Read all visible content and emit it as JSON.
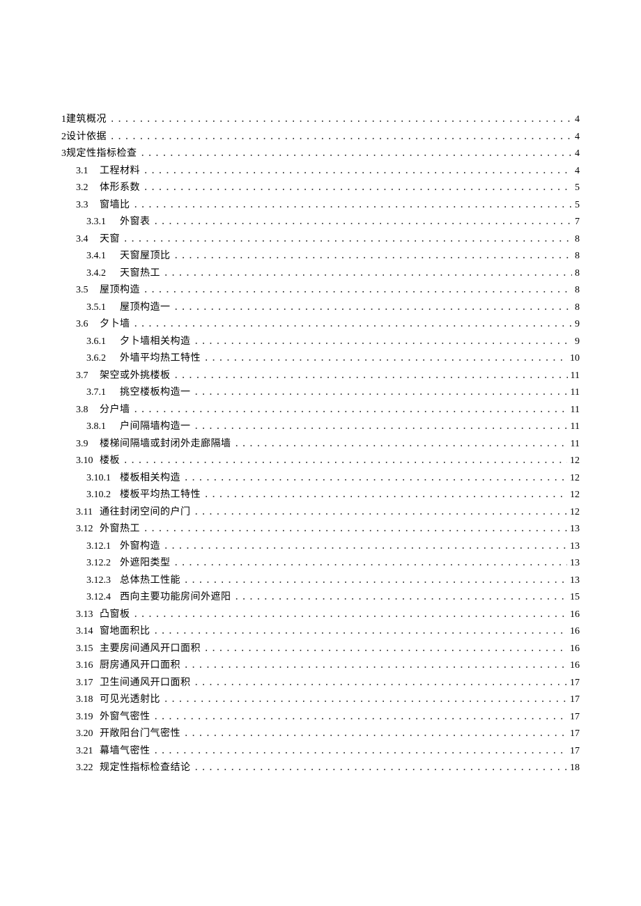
{
  "toc": [
    {
      "num": "1",
      "title": "建筑概况",
      "page": "4",
      "lvl": 1,
      "bold": false,
      "space": ""
    },
    {
      "num": "2",
      "title": "设计依据",
      "page": "4",
      "lvl": 1,
      "bold": false,
      "space": ""
    },
    {
      "num": "3",
      "title": "规定性指标检查",
      "page": "4",
      "lvl": 1,
      "bold": false,
      "space": ""
    },
    {
      "num": "3.1",
      "title": "工程材料",
      "page": "4",
      "lvl": 2,
      "bold": false,
      "space": ""
    },
    {
      "num": "3.2",
      "title": "体形系数",
      "page": "5",
      "lvl": 2,
      "bold": false,
      "space": ""
    },
    {
      "num": "3.3",
      "title": "窗墙比",
      "page": "5",
      "lvl": 2,
      "bold": false,
      "space": ""
    },
    {
      "num": "3.3.1",
      "title": "外窗表",
      "page": "7",
      "lvl": 3,
      "bold": false,
      "space": ""
    },
    {
      "num": "3.4",
      "title": "天窗",
      "page": "8",
      "lvl": 2,
      "bold": false,
      "space": ""
    },
    {
      "num": "3.4.1",
      "title": "天窗屋顶比",
      "page": "8",
      "lvl": 3,
      "bold": false,
      "space": ""
    },
    {
      "num": "3.4.2",
      "title": "天窗热工",
      "page": "8",
      "lvl": 3,
      "bold": false,
      "space": ""
    },
    {
      "num": "3.5",
      "title": "屋顶构造",
      "page": "8",
      "lvl": 2,
      "bold": false,
      "space": ""
    },
    {
      "num": "3.5.1",
      "title": "屋顶构造一",
      "page": "8",
      "lvl": 3,
      "bold": false,
      "space": ""
    },
    {
      "num": "3.6",
      "title": "夕卜墙",
      "page": "9",
      "lvl": 2,
      "bold": false,
      "space": ""
    },
    {
      "num": "3.6.1",
      "title": "夕卜墙相关构造",
      "page": "9",
      "lvl": 3,
      "bold": false,
      "space": ""
    },
    {
      "num": "3.6.2",
      "title": "外墙平均热工特性",
      "page": "10",
      "lvl": 3,
      "bold": false,
      "space": ""
    },
    {
      "num": "3.7",
      "title": "架空或外挑楼板",
      "page": "11",
      "lvl": 2,
      "bold": false,
      "space": ""
    },
    {
      "num": "3.7.1",
      "title": "挑空楼板构造一",
      "page": "11",
      "lvl": 3,
      "bold": false,
      "space": ""
    },
    {
      "num": "3.8",
      "title": "分户墙",
      "page": "11",
      "lvl": 2,
      "bold": false,
      "space": ""
    },
    {
      "num": "3.8.1",
      "title": "户间隔墙构造一",
      "page": "11",
      "lvl": 3,
      "bold": false,
      "space": ""
    },
    {
      "num": "3.9",
      "title": "楼梯间隔墙或封闭外走廊隔墙",
      "page": "11",
      "lvl": 2,
      "bold": false,
      "space": ""
    },
    {
      "num": "3.10",
      "title": "楼板",
      "page": "12",
      "lvl": 2,
      "bold": false,
      "space": ""
    },
    {
      "num": "3.10.1",
      "title": "楼板相关构造",
      "page": "12",
      "lvl": 3,
      "bold": false,
      "space": ""
    },
    {
      "num": "3.10.2",
      "title": "楼板平均热工特性",
      "page": "12",
      "lvl": 3,
      "bold": false,
      "space": ""
    },
    {
      "num": "3.11",
      "title": "通往封闭空间的户门",
      "page": "12",
      "lvl": 2,
      "bold": false,
      "space": ""
    },
    {
      "num": "3.12",
      "title": "外窗热工",
      "page": "13",
      "lvl": 2,
      "bold": false,
      "space": ""
    },
    {
      "num": "3.12.1",
      "title": "外窗构造",
      "page": "13",
      "lvl": 3,
      "bold": false,
      "space": ""
    },
    {
      "num": "3.12.2",
      "title": "外遮阳类型",
      "page": "13",
      "lvl": 3,
      "bold": false,
      "space": ""
    },
    {
      "num": "3.12.3",
      "title": "总体热工性能",
      "page": "13",
      "lvl": 3,
      "bold": false,
      "space": ""
    },
    {
      "num": "3.12.4",
      "title": "西向主要功能房间外遮阳",
      "page": "15",
      "lvl": 3,
      "bold": false,
      "space": ""
    },
    {
      "num": "3.13",
      "title": "凸窗板",
      "page": "16",
      "lvl": 2,
      "bold": false,
      "space": ""
    },
    {
      "num": "3.14",
      "title": "窗地面积比",
      "page": "16",
      "lvl": 2,
      "bold": false,
      "space": ""
    },
    {
      "num": "3.15",
      "title": "主要房间通风开口面积",
      "page": "16",
      "lvl": 2,
      "bold": false,
      "space": ""
    },
    {
      "num": "3.16",
      "title": "厨房通风开口面积",
      "page": "16",
      "lvl": 2,
      "bold": false,
      "space": ""
    },
    {
      "num": "3.17",
      "title": "卫生间通风开口面积",
      "page": "17",
      "lvl": 2,
      "bold": false,
      "space": ""
    },
    {
      "num": "3.18",
      "title": "可见光透射比",
      "page": "17",
      "lvl": 2,
      "bold": false,
      "space": ""
    },
    {
      "num": "3.19",
      "title": "外窗气密性",
      "page": "17",
      "lvl": 2,
      "bold": false,
      "space": ""
    },
    {
      "num": "3.20",
      "title": "开敞阳台门气密性",
      "page": "17",
      "lvl": 2,
      "bold": false,
      "space": ""
    },
    {
      "num": "3.21",
      "title": "幕墙气密性",
      "page": "17",
      "lvl": 2,
      "bold": false,
      "space": ""
    },
    {
      "num": "3.22",
      "title": "规定性指标检查结论",
      "page": "18",
      "lvl": 2,
      "bold": false,
      "space": ""
    }
  ]
}
